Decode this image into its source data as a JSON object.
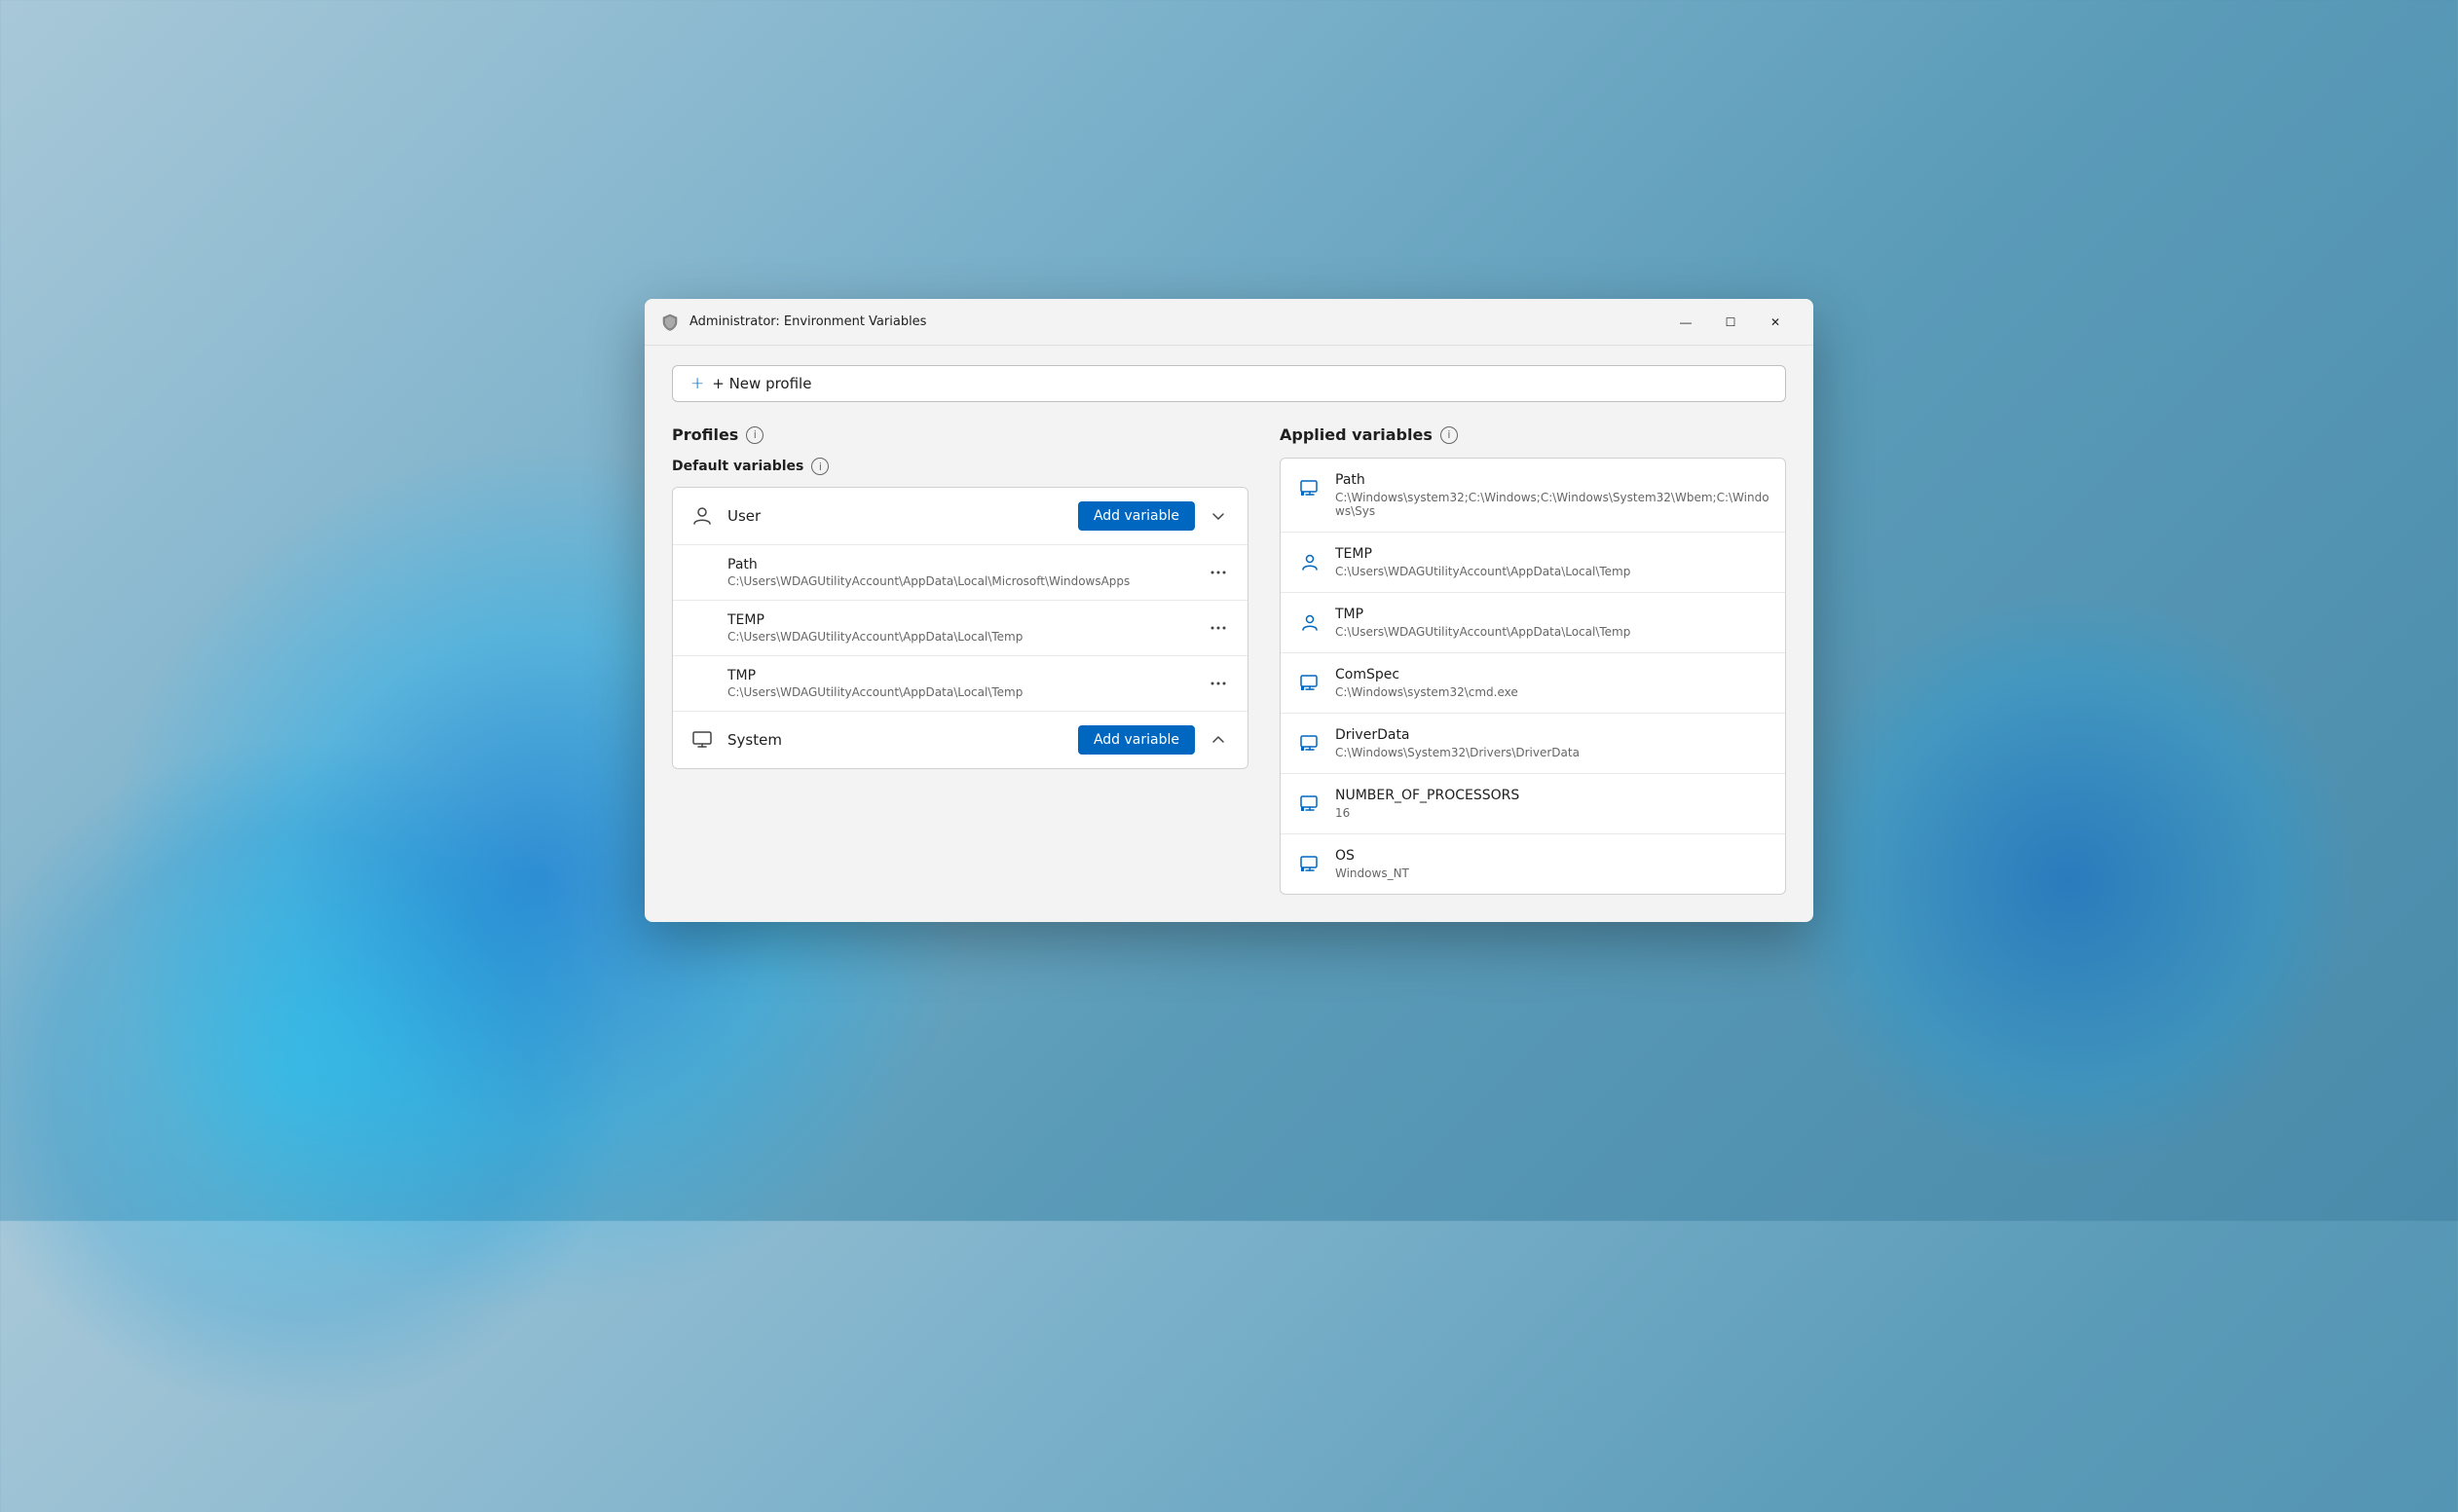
{
  "window": {
    "title": "Administrator: Environment Variables",
    "icon_label": "admin-icon"
  },
  "title_controls": {
    "minimize": "—",
    "maximize": "☐",
    "close": "✕"
  },
  "new_profile_btn": "+ New profile",
  "sections": {
    "profiles_label": "Profiles",
    "default_variables_label": "Default variables",
    "applied_variables_label": "Applied variables"
  },
  "user_category": {
    "label": "User",
    "add_variable_btn": "Add variable"
  },
  "system_category": {
    "label": "System",
    "add_variable_btn": "Add variable"
  },
  "user_variables": [
    {
      "name": "Path",
      "value": "C:\\Users\\WDAGUtilityAccount\\AppData\\Local\\Microsoft\\WindowsApps"
    },
    {
      "name": "TEMP",
      "value": "C:\\Users\\WDAGUtilityAccount\\AppData\\Local\\Temp"
    },
    {
      "name": "TMP",
      "value": "C:\\Users\\WDAGUtilityAccount\\AppData\\Local\\Temp"
    }
  ],
  "applied_variables": [
    {
      "name": "Path",
      "value": "C:\\Windows\\system32;C:\\Windows;C:\\Windows\\System32\\Wbem;C:\\Windows\\Sys",
      "icon_type": "system"
    },
    {
      "name": "TEMP",
      "value": "C:\\Users\\WDAGUtilityAccount\\AppData\\Local\\Temp",
      "icon_type": "user"
    },
    {
      "name": "TMP",
      "value": "C:\\Users\\WDAGUtilityAccount\\AppData\\Local\\Temp",
      "icon_type": "user"
    },
    {
      "name": "ComSpec",
      "value": "C:\\Windows\\system32\\cmd.exe",
      "icon_type": "system"
    },
    {
      "name": "DriverData",
      "value": "C:\\Windows\\System32\\Drivers\\DriverData",
      "icon_type": "system"
    },
    {
      "name": "NUMBER_OF_PROCESSORS",
      "value": "16",
      "icon_type": "system"
    },
    {
      "name": "OS",
      "value": "Windows_NT",
      "icon_type": "system"
    }
  ]
}
